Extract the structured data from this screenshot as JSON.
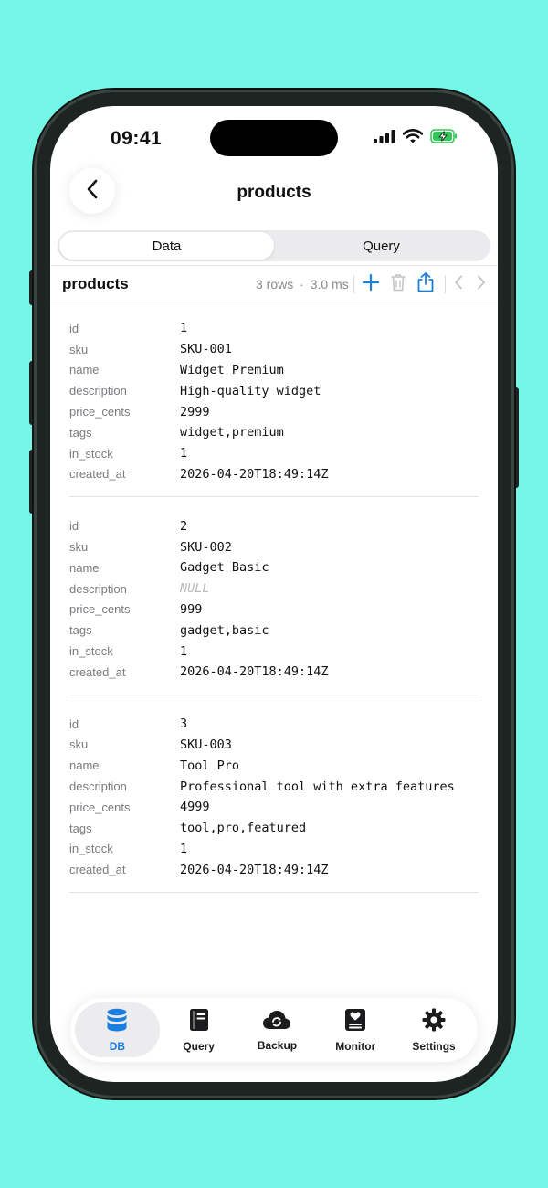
{
  "status": {
    "time": "09:41"
  },
  "nav": {
    "title": "products"
  },
  "segments": [
    {
      "label": "Data",
      "active": true
    },
    {
      "label": "Query",
      "active": false
    }
  ],
  "toolbar": {
    "table_name": "products",
    "rows": "3 rows",
    "separator": "·",
    "duration": "3.0 ms",
    "icons": [
      "plus-icon",
      "trash-icon",
      "share-icon",
      "chevron-left-icon",
      "chevron-right-icon"
    ]
  },
  "records": [
    {
      "fields": [
        {
          "key": "id",
          "value": "1"
        },
        {
          "key": "sku",
          "value": "SKU-001"
        },
        {
          "key": "name",
          "value": "Widget Premium"
        },
        {
          "key": "description",
          "value": "High-quality widget"
        },
        {
          "key": "price_cents",
          "value": "2999"
        },
        {
          "key": "tags",
          "value": "widget,premium"
        },
        {
          "key": "in_stock",
          "value": "1"
        },
        {
          "key": "created_at",
          "value": "2026-04-20T18:49:14Z"
        }
      ]
    },
    {
      "fields": [
        {
          "key": "id",
          "value": "2"
        },
        {
          "key": "sku",
          "value": "SKU-002"
        },
        {
          "key": "name",
          "value": "Gadget Basic"
        },
        {
          "key": "description",
          "value": "NULL",
          "is_null": true
        },
        {
          "key": "price_cents",
          "value": "999"
        },
        {
          "key": "tags",
          "value": "gadget,basic"
        },
        {
          "key": "in_stock",
          "value": "1"
        },
        {
          "key": "created_at",
          "value": "2026-04-20T18:49:14Z"
        }
      ]
    },
    {
      "fields": [
        {
          "key": "id",
          "value": "3"
        },
        {
          "key": "sku",
          "value": "SKU-003"
        },
        {
          "key": "name",
          "value": "Tool Pro"
        },
        {
          "key": "description",
          "value": "Professional tool with extra features"
        },
        {
          "key": "price_cents",
          "value": "4999"
        },
        {
          "key": "tags",
          "value": "tool,pro,featured"
        },
        {
          "key": "in_stock",
          "value": "1"
        },
        {
          "key": "created_at",
          "value": "2026-04-20T18:49:14Z"
        }
      ]
    }
  ],
  "tabbar": [
    {
      "label": "DB",
      "icon": "database-icon",
      "active": true
    },
    {
      "label": "Query",
      "icon": "book-icon",
      "active": false
    },
    {
      "label": "Backup",
      "icon": "cloud-sync-icon",
      "active": false
    },
    {
      "label": "Monitor",
      "icon": "heart-monitor-icon",
      "active": false
    },
    {
      "label": "Settings",
      "icon": "gear-icon",
      "active": false
    }
  ],
  "colors": {
    "background": "#74F7E6",
    "accent": "#1A7FE0",
    "battery": "#34C759"
  }
}
